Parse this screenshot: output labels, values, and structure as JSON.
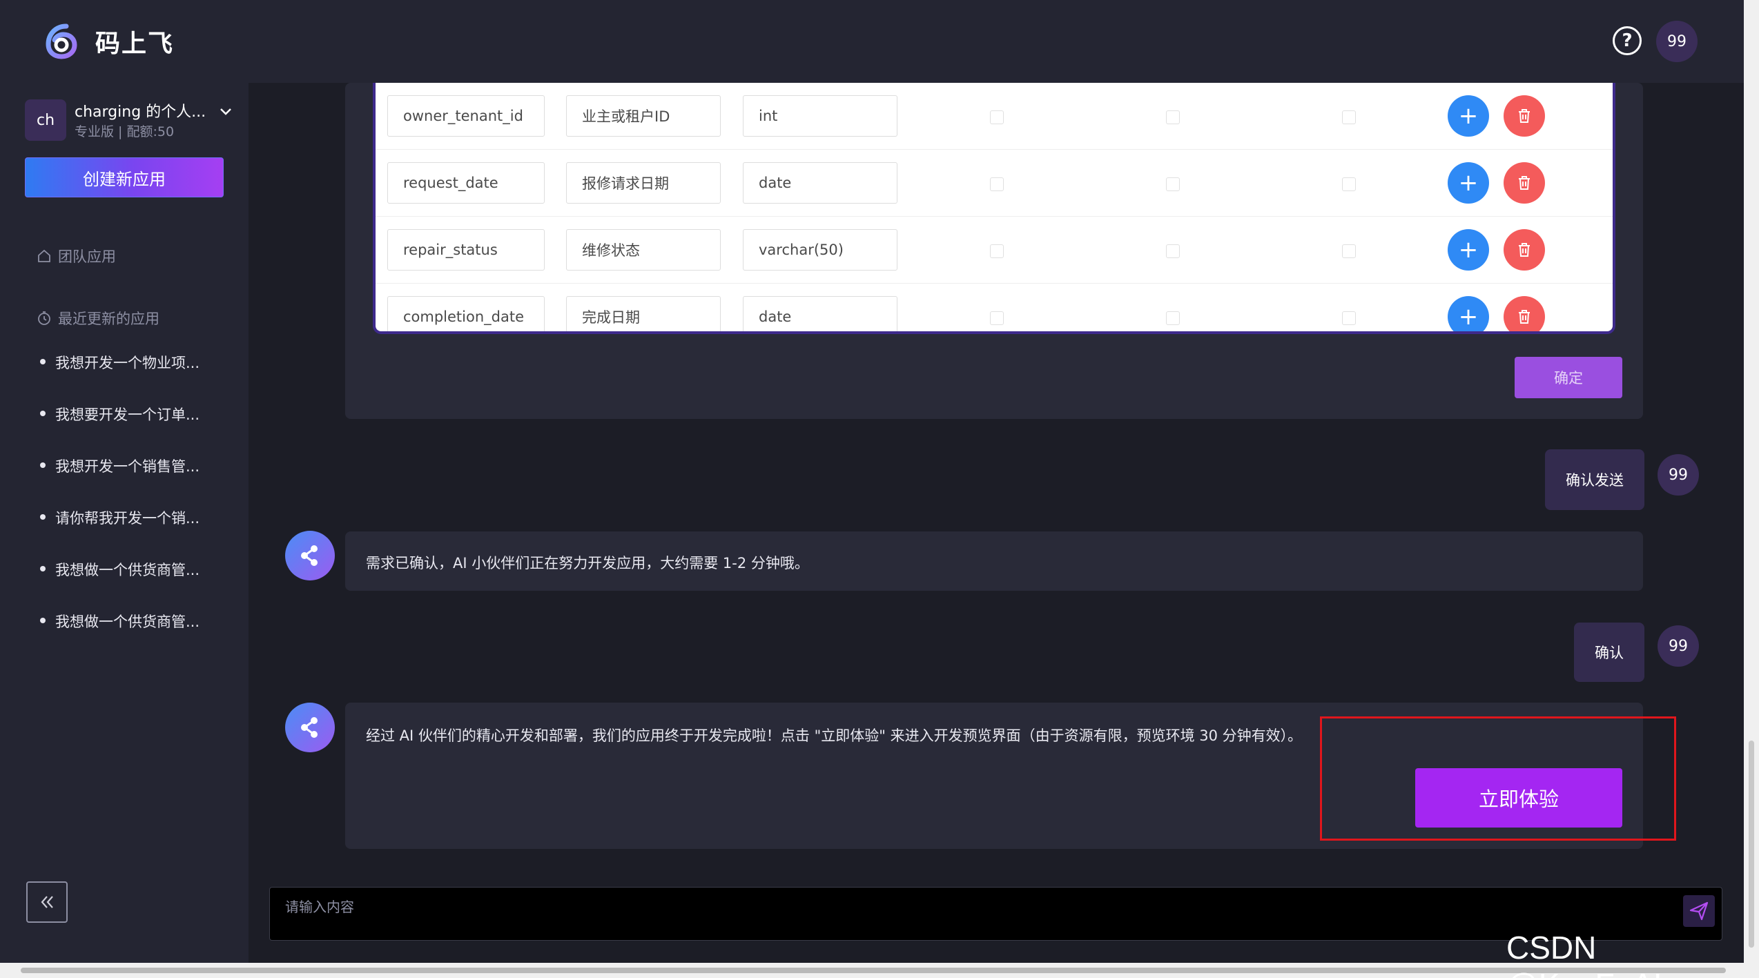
{
  "header": {
    "brand": "码上飞",
    "help_icon": "question-circle-icon",
    "avatar_text": "99"
  },
  "sidebar": {
    "avatar_text": "ch",
    "user_name": "charging 的个人...",
    "user_meta": "专业版  |  配额:50",
    "create_label": "创建新应用",
    "team_apps_label": "团队应用",
    "recent_label": "最近更新的应用",
    "recent_items": [
      "我想开发一个物业项...",
      "我想要开发一个订单...",
      "我想开发一个销售管...",
      "请你帮我开发一个销...",
      "我想做一个供货商管...",
      "我想做一个供货商管..."
    ]
  },
  "fields_table": {
    "rows": [
      {
        "name": "owner_tenant_id",
        "comment": "业主或租户ID",
        "type": "int"
      },
      {
        "name": "request_date",
        "comment": "报修请求日期",
        "type": "date"
      },
      {
        "name": "repair_status",
        "comment": "维修状态",
        "type": "varchar(50)"
      },
      {
        "name": "completion_date",
        "comment": "完成日期",
        "type": "date"
      }
    ],
    "confirm_label": "确定"
  },
  "chat": {
    "user_avatar_text": "99",
    "msg1_user": "确认发送",
    "msg2_ai": "需求已确认，AI 小伙伴们正在努力开发应用，大约需要 1-2 分钟哦。",
    "msg3_user": "确认",
    "msg4_ai": "经过 AI 伙伴们的精心开发和部署，我们的应用终于开发完成啦！点击 \"立即体验\" 来进入开发预览界面（由于资源有限，预览环境 30 分钟有效）。",
    "try_label": "立即体验"
  },
  "composer": {
    "placeholder": "请输入内容"
  },
  "watermark": "CSDN @KuaFuAI",
  "colors": {
    "accent": "#a426f2",
    "add": "#2f8af5",
    "delete": "#f45b5b",
    "highlight_box": "#e0161c"
  }
}
